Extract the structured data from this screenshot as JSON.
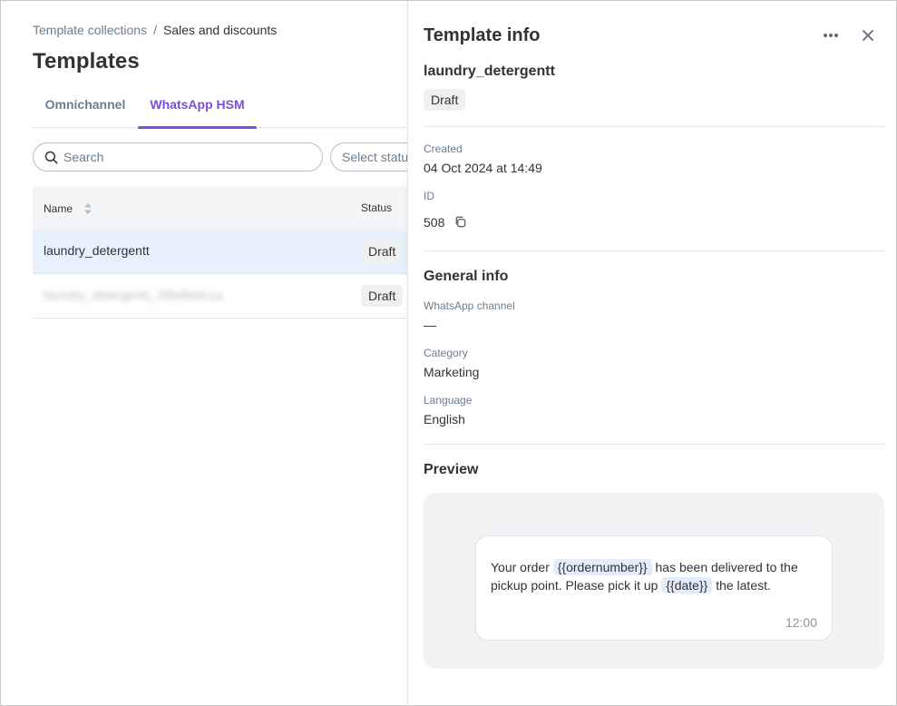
{
  "breadcrumb": {
    "parent": "Template collections",
    "separator": "/",
    "current": "Sales and discounts"
  },
  "page_title": "Templates",
  "tabs": [
    {
      "label": "Omnichannel",
      "active": false
    },
    {
      "label": "WhatsApp HSM",
      "active": true
    }
  ],
  "search": {
    "placeholder": "Search",
    "value": ""
  },
  "status_filter": {
    "placeholder": "Select status"
  },
  "table": {
    "columns": [
      "Name",
      "Status"
    ],
    "rows": [
      {
        "name": "laundry_detergentt",
        "status": "Draft"
      },
      {
        "name": "laundry_detergentt_2f8e6b9c1a",
        "status": "Draft"
      }
    ]
  },
  "panel": {
    "title": "Template info",
    "template_name": "laundry_detergentt",
    "status": "Draft",
    "created_label": "Created",
    "created_value": "04 Oct 2024 at 14:49",
    "id_label": "ID",
    "id_value": "508",
    "general_title": "General info",
    "channel_label": "WhatsApp channel",
    "channel_value": "—",
    "category_label": "Category",
    "category_value": "Marketing",
    "language_label": "Language",
    "language_value": "English",
    "preview_title": "Preview",
    "preview": {
      "text_1": "Your order",
      "var_1": "{{ordernumber}}",
      "text_2": "has been delivered to the pickup point. Please pick it up",
      "var_2": "{{date}}",
      "text_3": "the latest.",
      "time": "12:00"
    }
  },
  "colors": {
    "accent": "#7d4ce0",
    "selected_row": "#e8f0fd",
    "muted_text": "#6b7d8e"
  }
}
